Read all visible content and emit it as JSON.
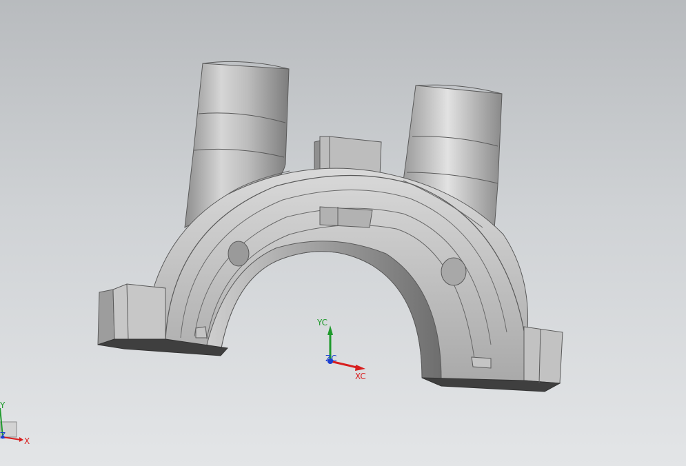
{
  "viewport": {
    "background_top": "#b8bbbe",
    "background_bottom": "#e3e5e7"
  },
  "wcs_triad": {
    "x_label": "XC",
    "y_label": "YC",
    "z_label": "ZC",
    "x_color": "#d81e1e",
    "y_color": "#1f9a2c",
    "z_color": "#1b3fd1"
  },
  "view_triad": {
    "x_label": "X",
    "y_label": "Y",
    "z_label": "Z"
  },
  "model": {
    "icon": "shift-fork-casting-model",
    "shade_color": "#b9b9b9"
  }
}
